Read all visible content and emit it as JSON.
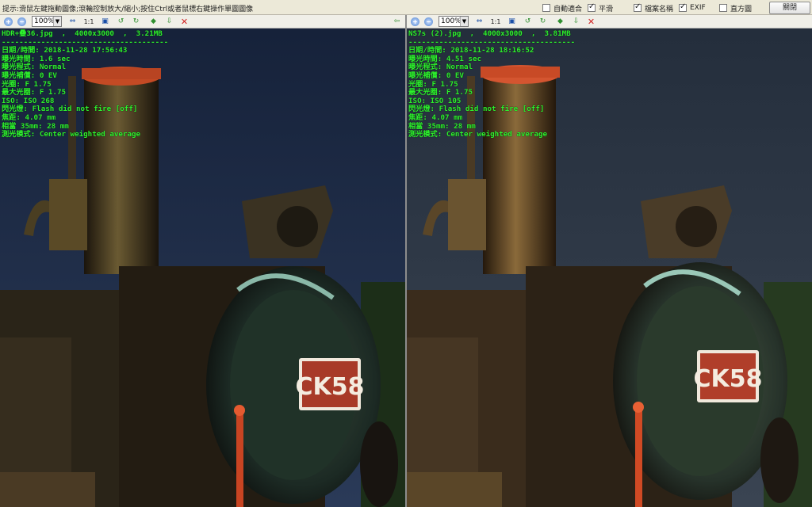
{
  "topbar": {
    "hint": "提示:滑鼠左鍵拖動圖像;滾輪控制放大/縮小;按住Ctrl或者鼠標右鍵操作單圖圖像",
    "options": [
      {
        "label": "自動適合",
        "checked": false
      },
      {
        "label": "平滑",
        "checked": true
      },
      {
        "label": "檔案名稱",
        "checked": true
      },
      {
        "label": "EXIF",
        "checked": true
      },
      {
        "label": "直方圖",
        "checked": false
      }
    ],
    "close_label": "關閉"
  },
  "panes": [
    {
      "zoom": "100%",
      "header": "HDR+疊36.jpg  ,  4000x3000  ,  3.21MB",
      "separator": "--------------------------------------",
      "exif": [
        "日期/時間: 2018-11-28 17:56:43",
        "曝光時間: 1.6 sec",
        "曝光程式: Normal",
        "曝光補償: 0 EV",
        "光圈: F 1.75",
        "最大光圈: F 1.75",
        "ISO: ISO 268",
        "閃光燈: Flash did not fire [off]",
        "焦距: 4.07 mm",
        "相當 35mm: 28 mm",
        "測光模式: Center weighted average"
      ],
      "plate": "CK58",
      "colors": {
        "sky": "#1d2a44",
        "body": "#2a2218",
        "cap": "#c8502a"
      }
    },
    {
      "zoom": "100%",
      "header": "NS7s (2).jpg  ,  4000x3000  ,  3.81MB",
      "separator": "--------------------------------------",
      "exif": [
        "日期/時間: 2018-11-28 18:16:52",
        "曝光時間: 4.51 sec",
        "曝光程式: Normal",
        "曝光補償: 0 EV",
        "光圈: F 1.75",
        "最大光圈: F 1.75",
        "ISO: ISO 105",
        "閃光燈: Flash did not fire [off]",
        "焦距: 4.07 mm",
        "相當 35mm: 28 mm",
        "測光模式: Center weighted average"
      ],
      "plate": "CK58",
      "colors": {
        "sky": "#2c3646",
        "body": "#3a2c1c",
        "cap": "#d45530"
      }
    }
  ],
  "toolbar_icons": [
    "zoom-in-icon",
    "zoom-out-icon",
    "fit-icon",
    "actual-size-icon",
    "fit-screen-icon",
    "rotate-left-icon",
    "rotate-right-icon",
    "save-icon",
    "export-icon",
    "delete-icon",
    "sync-arrow-icon"
  ]
}
